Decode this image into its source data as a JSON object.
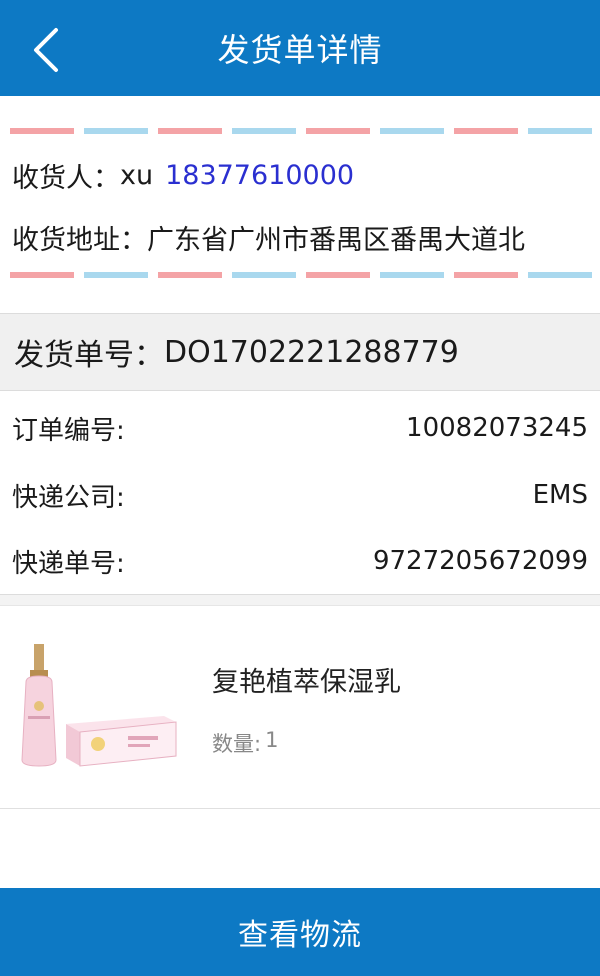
{
  "header": {
    "title": "发货单详情",
    "back_icon": "chevron-left-icon",
    "color": "#0d79c4"
  },
  "receiver": {
    "label": "收货人：",
    "name": "xu",
    "phone": "18377610000",
    "phone_color": "#2a2fd0",
    "address_label": "收货地址：",
    "address": "广东省广州市番禺区番禺大道北"
  },
  "waybill": {
    "label": "发货单号：",
    "number": "DO1702221288779"
  },
  "info": [
    {
      "label": "订单编号:",
      "value": "10082073245"
    },
    {
      "label": "快递公司:",
      "value": "EMS"
    },
    {
      "label": "快递单号:",
      "value": "9727205672099"
    }
  ],
  "product": {
    "name": "复艳植萃保湿乳",
    "qty_label": "数量:",
    "qty_value": "1",
    "image_icon": "product-photo"
  },
  "footer": {
    "button_label": "查看物流",
    "color": "#0d79c4"
  },
  "airmail_colors": [
    "#f4a3a6",
    "#a9d8ee"
  ]
}
